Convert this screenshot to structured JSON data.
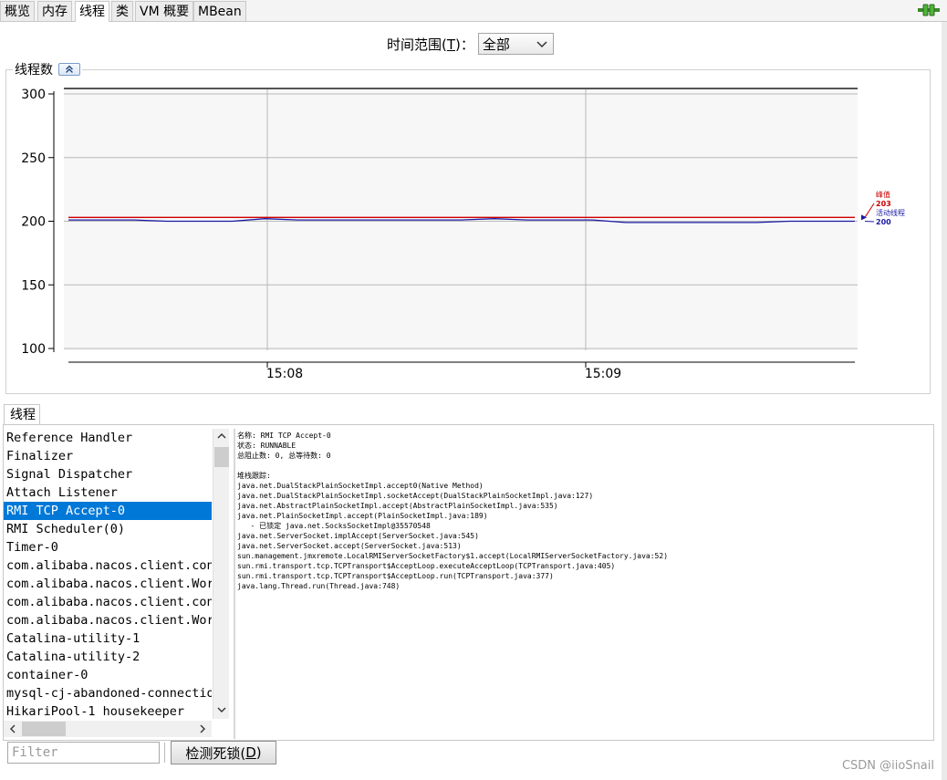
{
  "tabs": [
    {
      "label": "概览"
    },
    {
      "label": "内存"
    },
    {
      "label": "线程"
    },
    {
      "label": "类"
    },
    {
      "label": "VM 概要"
    },
    {
      "label": "MBean"
    }
  ],
  "active_tab": 2,
  "time_range": {
    "label_prefix": "时间范围(",
    "mnemonic": "T",
    "label_suffix": ")：",
    "selected": "全部"
  },
  "chart_panel": {
    "title": "线程数"
  },
  "chart_data": {
    "type": "line",
    "x_tick_labels": [
      "15:08",
      "15:09"
    ],
    "ylim": [
      100,
      300
    ],
    "y_ticks": [
      100,
      150,
      200,
      250,
      300
    ],
    "grid": true,
    "legend": "right",
    "series": [
      {
        "name": "峰值",
        "current": "203",
        "color": "#cc0000",
        "values": [
          203,
          203,
          203,
          203,
          203,
          203,
          203,
          203,
          203,
          203,
          203,
          203,
          203,
          203,
          203,
          203,
          203,
          203,
          203,
          203,
          203,
          203,
          203,
          203,
          203
        ]
      },
      {
        "name": "活动线程",
        "current": "200",
        "color": "#1a1aa6",
        "values": [
          201,
          201,
          201,
          200,
          200,
          200,
          202,
          201,
          201,
          201,
          201,
          201,
          201,
          202,
          201,
          201,
          201,
          199,
          199,
          199,
          199,
          199,
          200,
          200,
          200
        ]
      }
    ]
  },
  "threads_tab": {
    "label": "线程"
  },
  "thread_list": [
    "Reference Handler",
    "Finalizer",
    "Signal Dispatcher",
    "Attach Listener",
    "RMI TCP Accept-0",
    "RMI Scheduler(0)",
    "Timer-0",
    "com.alibaba.nacos.client.con",
    "com.alibaba.nacos.client.Wor",
    "com.alibaba.nacos.client.con",
    "com.alibaba.nacos.client.Wor",
    "Catalina-utility-1",
    "Catalina-utility-2",
    "container-0",
    "mysql-cj-abandoned-connectio",
    "HikariPool-1 housekeeper"
  ],
  "selected_thread_index": 4,
  "thread_detail": [
    "名称: RMI TCP Accept-0",
    "状态: RUNNABLE",
    "总阻止数: 0, 总等待数: 0",
    "",
    "堆栈跟踪:",
    "java.net.DualStackPlainSocketImpl.accept0(Native Method)",
    "java.net.DualStackPlainSocketImpl.socketAccept(DualStackPlainSocketImpl.java:127)",
    "java.net.AbstractPlainSocketImpl.accept(AbstractPlainSocketImpl.java:535)",
    "java.net.PlainSocketImpl.accept(PlainSocketImpl.java:189)",
    "   - 已锁定 java.net.SocksSocketImpl@35570548",
    "java.net.ServerSocket.implAccept(ServerSocket.java:545)",
    "java.net.ServerSocket.accept(ServerSocket.java:513)",
    "sun.management.jmxremote.LocalRMIServerSocketFactory$1.accept(LocalRMIServerSocketFactory.java:52)",
    "sun.rmi.transport.tcp.TCPTransport$AcceptLoop.executeAcceptLoop(TCPTransport.java:405)",
    "sun.rmi.transport.tcp.TCPTransport$AcceptLoop.run(TCPTransport.java:377)",
    "java.lang.Thread.run(Thread.java:748)"
  ],
  "filter": {
    "placeholder": "Filter"
  },
  "detect_button": {
    "label_prefix": "检测死锁(",
    "mnemonic": "D",
    "label_suffix": ")"
  },
  "watermark": "CSDN @iioSnail"
}
